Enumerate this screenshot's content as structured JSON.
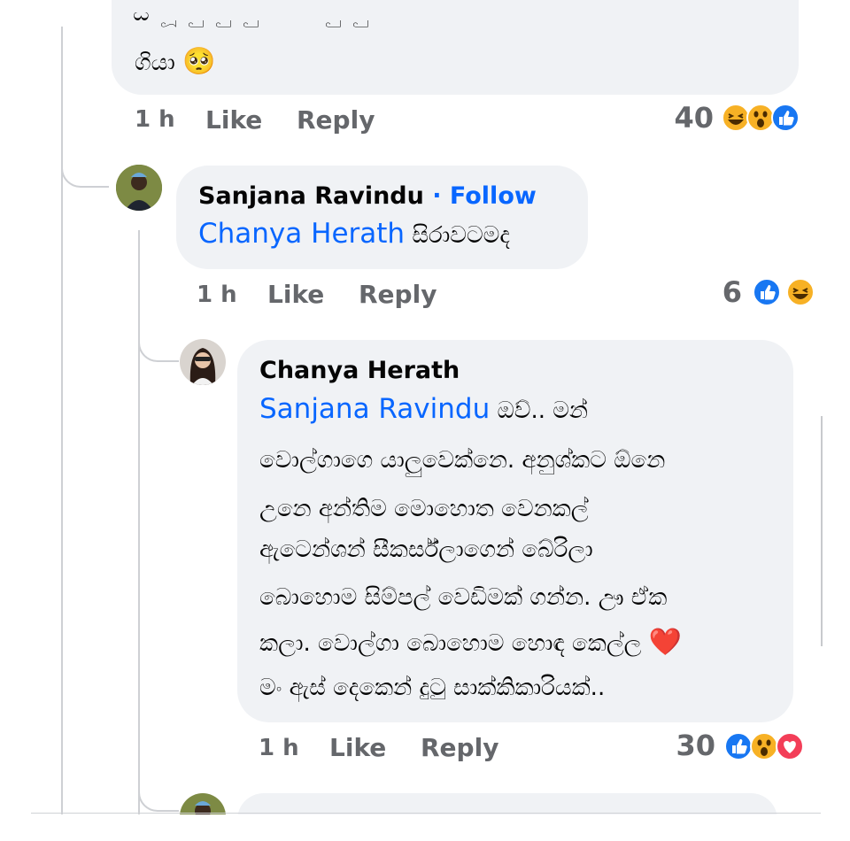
{
  "comment_top": {
    "text_tail": "ගියා",
    "emoji": "🥺",
    "time": "1 h",
    "like_label": "Like",
    "reply_label": "Reply",
    "reaction_count": "40",
    "reactions": [
      "haha-icon",
      "wow-icon",
      "like-icon"
    ]
  },
  "reply_1": {
    "author": "Sanjana Ravindu",
    "follow_label": "· Follow",
    "mention": "Chanya Herath",
    "text": "සිරාවටමද",
    "time": "1 h",
    "like_label": "Like",
    "reply_label": "Reply",
    "reaction_count": "6",
    "reactions": [
      "like-icon",
      "haha-icon"
    ]
  },
  "reply_2": {
    "author": "Chanya Herath",
    "mention": "Sanjana Ravindu",
    "line1": "ඔව්.. මන්",
    "line2": "වොල්ගාගෙ යාලුවෙක්නෙ.  අනුශ්කට ඕනෙ",
    "line3": "උනෙ අන්තිම මොහොත වෙනකල්",
    "line4": "ඇටෙන්ශන්  සීකර්ස්ලාගෙන් බේරිලා",
    "line5": "බොහොම සිම්පල් වෙඩිමක් ගන්න. ඌ ඒක",
    "line6": "කලා. වොල්ගා බොහොම හොඳ කෙල්ල",
    "line6_emoji": "❤️",
    "line7": "මං ඇස් දෙකෙන් දුටු සාක්කිකාරියක්..",
    "time": "1 h",
    "like_label": "Like",
    "reply_label": "Reply",
    "reaction_count": "30",
    "reactions": [
      "like-icon",
      "wow-icon",
      "love-icon"
    ]
  },
  "colors": {
    "bubble": "#f0f2f5",
    "link": "#0866ff",
    "meta": "#65676b",
    "like": "#1877f2",
    "love": "#f33e58",
    "emoji": "#f7b125"
  }
}
